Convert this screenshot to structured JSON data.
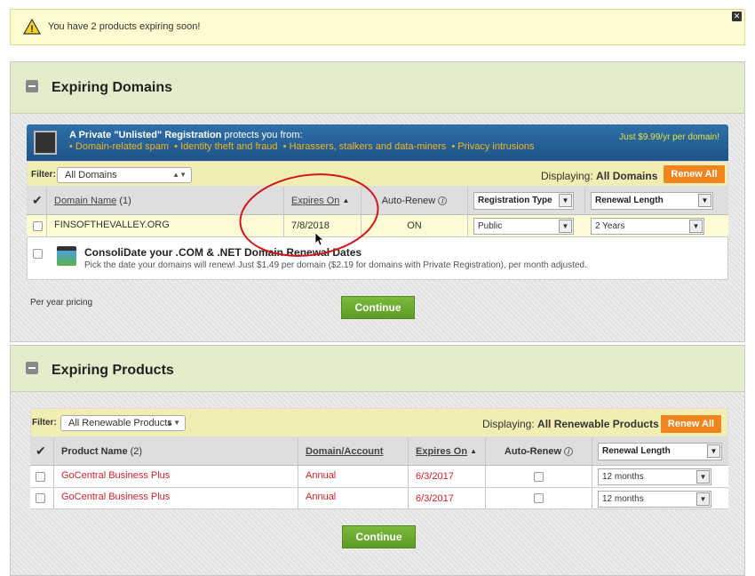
{
  "alert": {
    "message": "You have 2 products expiring soon!"
  },
  "domains": {
    "title": "Expiring Domains",
    "promo": {
      "headline": "A Private \"Unlisted\" Registration",
      "headline_suffix": " protects you from:",
      "bullets": "• Domain-related spam  • Identity theft and fraud  • Harassers, stalkers and data-miners  • Privacy intrusions",
      "price": "Just $9.99/yr per domain!"
    },
    "filter_label": "Filter:",
    "filter_value": "All Domains",
    "displaying_label": "Displaying:",
    "displaying_value": "All Domains",
    "renew_all": "Renew All",
    "columns": {
      "name": "Domain Name",
      "name_count": "(1)",
      "expires": "Expires On",
      "auto_renew": "Auto-Renew",
      "reg_type": "Registration Type",
      "renewal": "Renewal Length"
    },
    "rows": [
      {
        "name": "FINSOFTHEVALLEY.ORG",
        "expires": "7/8/2018",
        "auto_renew": "ON",
        "reg_type": "Public",
        "renewal": "2 Years"
      }
    ],
    "consolidate": {
      "title": "ConsoliDate your .COM & .NET Domain Renewal Dates",
      "desc": "Pick the date your domains will renew! Just $1.49 per domain ($2.19 for domains with Private Registration), per month adjusted."
    },
    "pricing_note": "Per year pricing",
    "continue": "Continue"
  },
  "products": {
    "title": "Expiring Products",
    "filter_label": "Filter:",
    "filter_value": "All Renewable Products",
    "displaying_label": "Displaying:",
    "displaying_value": "All Renewable Products",
    "renew_all": "Renew All",
    "columns": {
      "name": "Product Name",
      "name_count": "(2)",
      "domain": "Domain/Account",
      "expires": "Expires On",
      "auto_renew": "Auto-Renew",
      "renewal": "Renewal Length"
    },
    "rows": [
      {
        "name": "GoCentral Business Plus",
        "domain": "Annual",
        "expires": "6/3/2017",
        "renewal": "12 months"
      },
      {
        "name": "GoCentral Business Plus",
        "domain": "Annual",
        "expires": "6/3/2017",
        "renewal": "12 months"
      }
    ],
    "continue": "Continue"
  }
}
